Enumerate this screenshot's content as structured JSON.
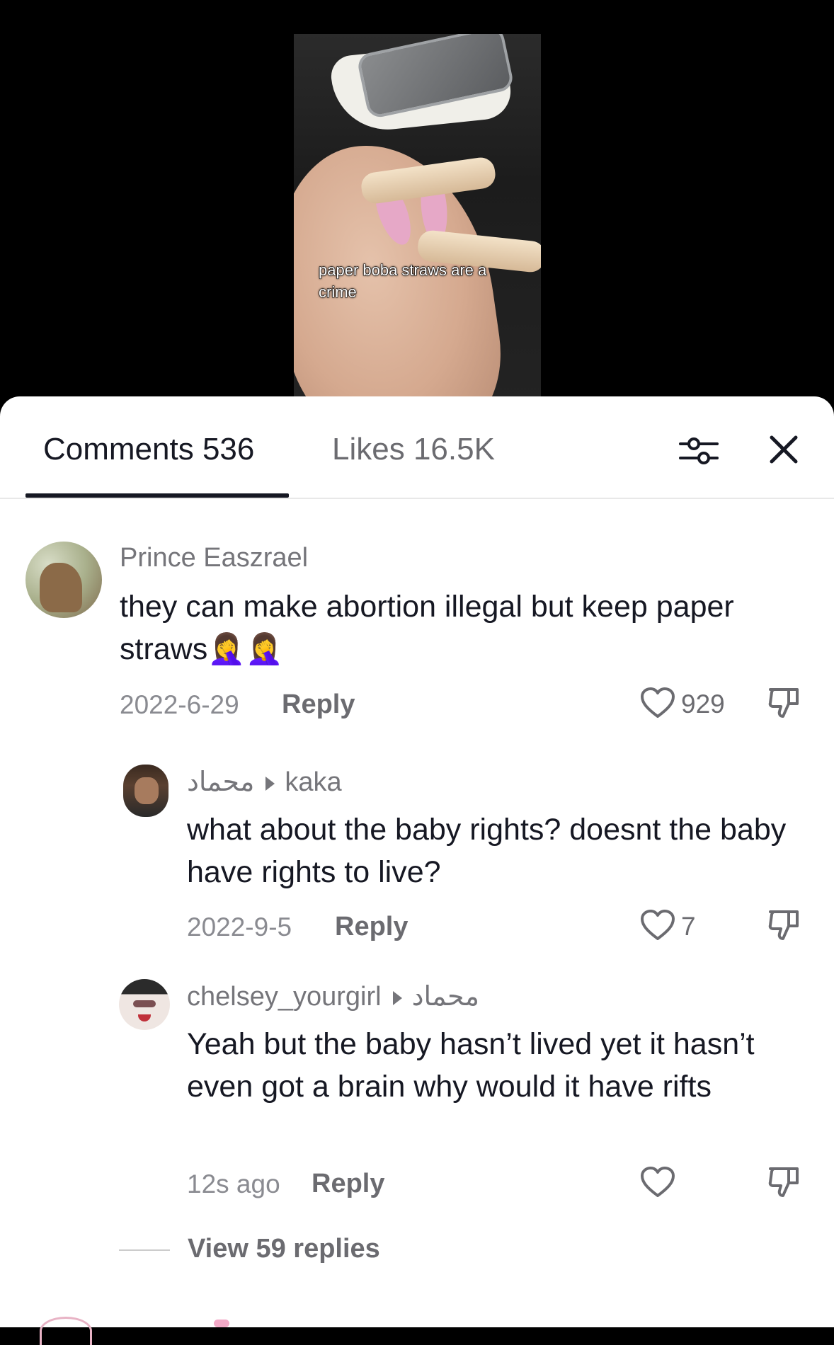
{
  "video": {
    "caption": "paper boba straws are a crime"
  },
  "tabs": {
    "comments_label": "Comments 536",
    "likes_label": "Likes 16.5K"
  },
  "comments": [
    {
      "username": "Prince Easzrael",
      "text": "they can make abortion illegal but keep paper straws🤦‍♀️🤦‍♀️",
      "date": "2022-6-29",
      "reply_label": "Reply",
      "likes": "929"
    },
    {
      "from": "محماد",
      "to": "kaka",
      "text": "what about the baby rights? doesnt the baby have rights to live?",
      "date": "2022-9-5",
      "reply_label": "Reply",
      "likes": "7"
    },
    {
      "from": "chelsey_yourgirl",
      "to": "محماد",
      "text": "Yeah but the baby hasn’t lived yet it hasn’t even got a brain why would it have rifts",
      "date": "12s ago",
      "reply_label": "Reply",
      "likes": ""
    }
  ],
  "view_replies_label": "View 59 replies",
  "colors": {
    "primary_text": "#161823",
    "secondary_text": "#75757a",
    "background": "#ffffff"
  }
}
